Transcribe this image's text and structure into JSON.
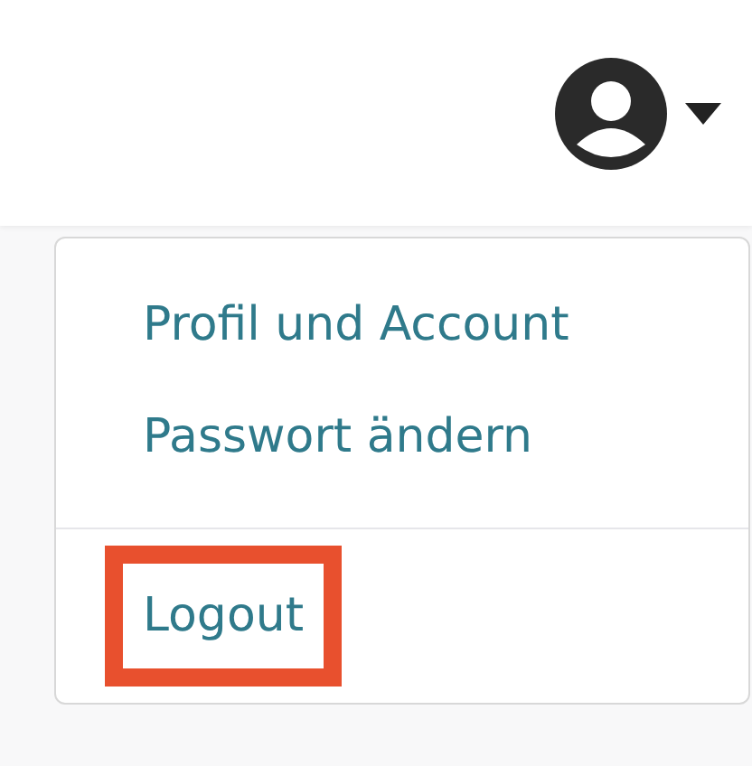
{
  "header": {
    "user_menu": {
      "expanded": true
    }
  },
  "dropdown": {
    "sections": [
      {
        "items": [
          {
            "label": "Profil und Account",
            "highlighted": false
          },
          {
            "label": "Passwort ändern",
            "highlighted": false
          }
        ]
      },
      {
        "items": [
          {
            "label": "Logout",
            "highlighted": true
          }
        ]
      }
    ]
  }
}
